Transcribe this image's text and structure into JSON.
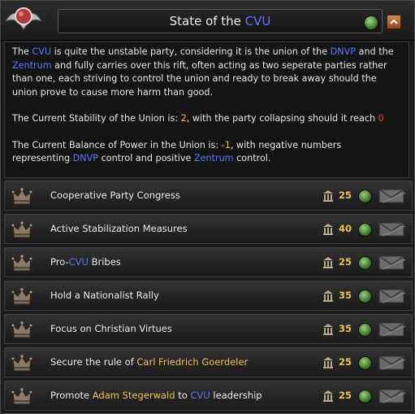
{
  "header": {
    "title_prefix": "State of the ",
    "title_highlight": "CVU"
  },
  "description": {
    "p1": [
      {
        "t": "The ",
        "c": ""
      },
      {
        "t": "CVU",
        "c": "blue"
      },
      {
        "t": " is quite the unstable party, considering it is the union of the ",
        "c": ""
      },
      {
        "t": "DNVP",
        "c": "blue"
      },
      {
        "t": " and the ",
        "c": ""
      },
      {
        "t": "Zentrum",
        "c": "blue"
      },
      {
        "t": " and fully carries over this rift, often acting as two seperate parties rather than one, each striving to control the union and ready to break away should the union prove to cause more harm than good.",
        "c": ""
      }
    ],
    "p2": [
      {
        "t": "The Current Stability of the Union is: ",
        "c": ""
      },
      {
        "t": "2",
        "c": "yellow"
      },
      {
        "t": ", with the party collapsing should it reach ",
        "c": ""
      },
      {
        "t": "0",
        "c": "red"
      }
    ],
    "p3": [
      {
        "t": "The Current Balance of Power in the Union is: ",
        "c": ""
      },
      {
        "t": "-1",
        "c": "yellow"
      },
      {
        "t": ", with negative numbers representing ",
        "c": ""
      },
      {
        "t": "DNVP",
        "c": "blue"
      },
      {
        "t": " control and positive ",
        "c": ""
      },
      {
        "t": "Zentrum",
        "c": "blue"
      },
      {
        "t": " control.",
        "c": ""
      }
    ]
  },
  "decisions": [
    {
      "label": [
        {
          "t": "Cooperative Party Congress",
          "c": ""
        }
      ],
      "cost": "25",
      "icon": "crown-icon"
    },
    {
      "label": [
        {
          "t": "Active Stabilization Measures",
          "c": ""
        }
      ],
      "cost": "40",
      "icon": "crown-icon"
    },
    {
      "label": [
        {
          "t": "Pro-",
          "c": ""
        },
        {
          "t": "CVU",
          "c": "blue"
        },
        {
          "t": " Bribes",
          "c": ""
        }
      ],
      "cost": "25",
      "icon": "crown-icon"
    },
    {
      "label": [
        {
          "t": "Hold a Nationalist Rally",
          "c": ""
        }
      ],
      "cost": "35",
      "icon": "crown-icon"
    },
    {
      "label": [
        {
          "t": "Focus on Christian Virtues",
          "c": ""
        }
      ],
      "cost": "35",
      "icon": "crown-icon"
    },
    {
      "label": [
        {
          "t": "Secure the rule of ",
          "c": ""
        },
        {
          "t": "Carl Friedrich Goerdeler",
          "c": "yellow"
        }
      ],
      "cost": "25",
      "icon": "crown-icon"
    },
    {
      "label": [
        {
          "t": "Promote ",
          "c": ""
        },
        {
          "t": "Adam Stegerwald",
          "c": "yellow"
        },
        {
          "t": " to ",
          "c": ""
        },
        {
          "t": "CVU",
          "c": "blue"
        },
        {
          "t": " leadership",
          "c": ""
        }
      ],
      "cost": "25",
      "icon": "crown-icon"
    }
  ],
  "colors": {
    "highlight_blue": "#5a79ff",
    "highlight_yellow": "#f2c14a",
    "highlight_red": "#ff3a2a",
    "status_green": "#4b8a36"
  }
}
